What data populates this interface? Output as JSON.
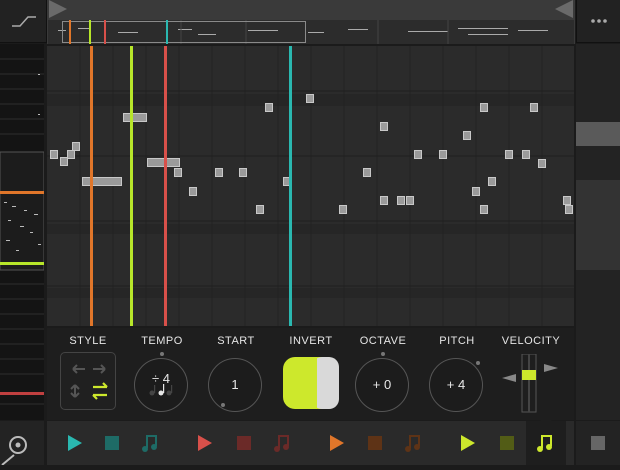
{
  "controls": {
    "style": {
      "label": "STYLE"
    },
    "tempo": {
      "label": "TEMPO",
      "value": "÷ 4"
    },
    "start": {
      "label": "START",
      "value": "1"
    },
    "invert": {
      "label": "INVERT"
    },
    "octave": {
      "label": "OCTAVE",
      "value": "+ 0"
    },
    "pitch": {
      "label": "PITCH",
      "value": "+ 4"
    },
    "velocity": {
      "label": "VELOCITY"
    }
  },
  "playheads": [
    {
      "name": "orange",
      "color": "#e0762a"
    },
    {
      "name": "lime",
      "color": "#b7e62a"
    },
    {
      "name": "red",
      "color": "#d8504a"
    },
    {
      "name": "cyan",
      "color": "#2ab8b0"
    }
  ],
  "tracks": [
    {
      "name": "cyan",
      "color": "#2ab8b0",
      "selected": false
    },
    {
      "name": "red",
      "color": "#d8504a",
      "selected": false
    },
    {
      "name": "orange",
      "color": "#e0762a",
      "selected": false
    },
    {
      "name": "lime",
      "color": "#cde82c",
      "selected": true
    }
  ],
  "icons": {
    "top_left": "curve-icon",
    "top_right": "more-icon",
    "bottom_left": "settings-icon",
    "bottom_right": "stop-icon"
  }
}
